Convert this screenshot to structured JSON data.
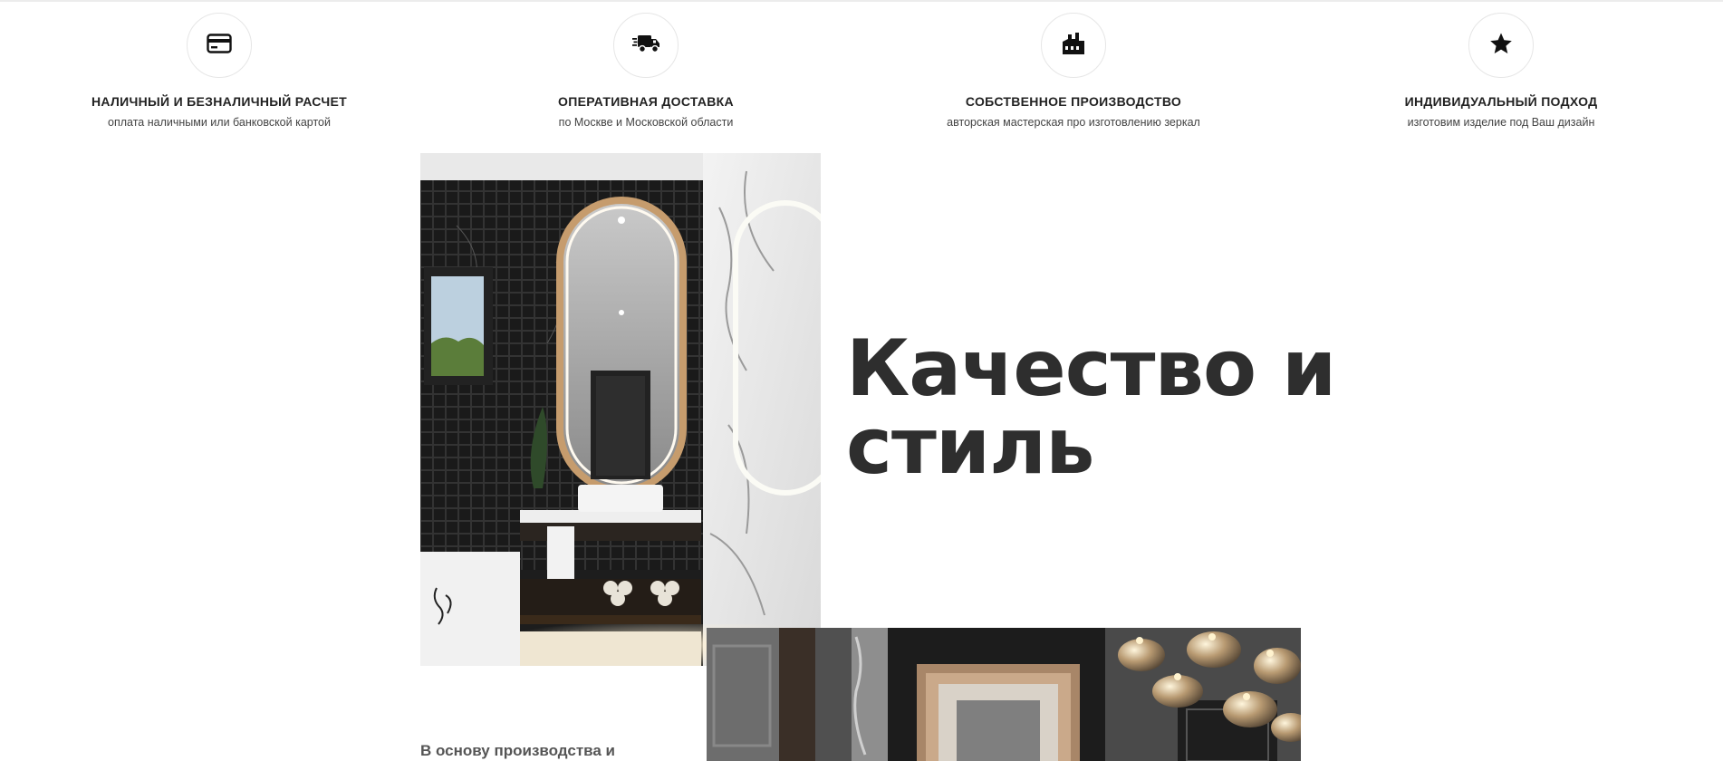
{
  "features": [
    {
      "icon": "credit-card-icon",
      "title": "НАЛИЧНЫЙ И БЕЗНАЛИЧНЫЙ РАСЧЕТ",
      "subtitle": "оплата наличными или банковской картой"
    },
    {
      "icon": "delivery-truck-icon",
      "title": "ОПЕРАТИВНАЯ ДОСТАВКА",
      "subtitle": "по Москве и Московской области"
    },
    {
      "icon": "factory-icon",
      "title": "СОБСТВЕННОЕ ПРОИЗВОДСТВО",
      "subtitle": "авторская мастерская про изготовлению зеркал"
    },
    {
      "icon": "star-icon",
      "title": "ИНДИВИДУАЛЬНЫЙ ПОДХОД",
      "subtitle": "изготовим изделие под Ваш дизайн"
    }
  ],
  "hero": {
    "headline_line1": "Качество и",
    "headline_line2": "стиль"
  },
  "intro_text": "В основу производства и"
}
